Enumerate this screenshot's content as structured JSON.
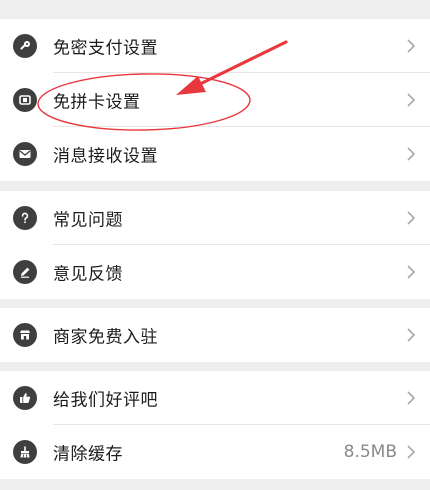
{
  "groups": [
    {
      "items": [
        {
          "label": "免密支付设置",
          "icon": "key-icon"
        },
        {
          "label": "免拼卡设置",
          "icon": "card-icon"
        },
        {
          "label": "消息接收设置",
          "icon": "mail-icon"
        }
      ]
    },
    {
      "items": [
        {
          "label": "常见问题",
          "icon": "question-icon"
        },
        {
          "label": "意见反馈",
          "icon": "pencil-icon"
        }
      ]
    },
    {
      "items": [
        {
          "label": "商家免费入驻",
          "icon": "store-icon"
        }
      ]
    },
    {
      "items": [
        {
          "label": "给我们好评吧",
          "icon": "thumbs-up-icon"
        },
        {
          "label": "清除缓存",
          "icon": "broom-icon",
          "value": "8.5MB"
        }
      ]
    }
  ],
  "colors": {
    "annotation": "#e8383d",
    "icon_bg": "#3f3f3f",
    "chevron": "#a8a8a8"
  }
}
